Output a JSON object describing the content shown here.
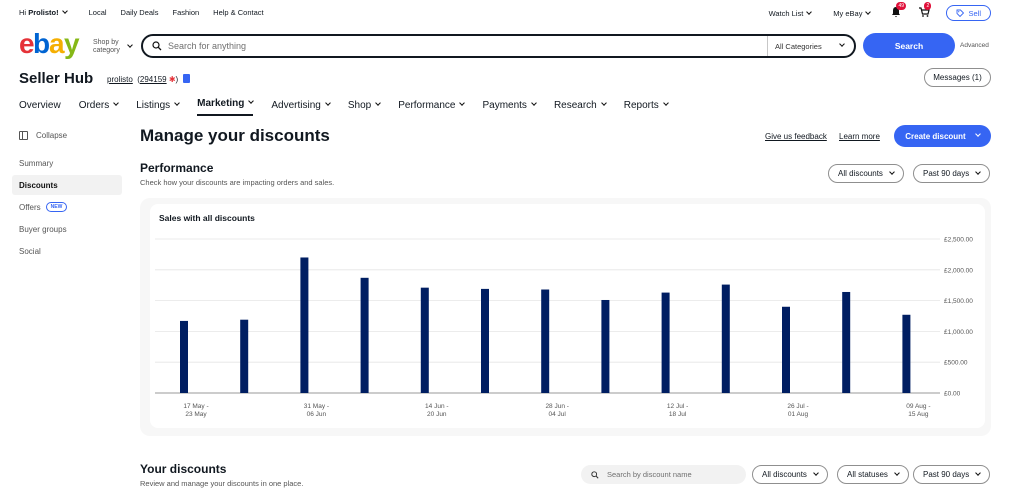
{
  "topbar": {
    "greeting_prefix": "Hi",
    "greeting_name": "Prolisto!",
    "links": [
      "Local",
      "Daily Deals",
      "Fashion",
      "Help & Contact"
    ],
    "watch_list": "Watch List",
    "my_ebay": "My eBay",
    "notif_count": "49",
    "cart_count": "2",
    "sell_label": "Sell"
  },
  "header": {
    "shop_by_line1": "Shop by",
    "shop_by_line2": "category",
    "search_placeholder": "Search for anything",
    "category_label": "All Categories",
    "search_button": "Search",
    "advanced_label": "Advanced"
  },
  "sellerhub": {
    "title": "Seller Hub",
    "username": "prolisto",
    "feedback_score": "294159",
    "messages_label": "Messages (1)"
  },
  "nav": {
    "items": [
      {
        "label": "Overview",
        "chevron": false
      },
      {
        "label": "Orders",
        "chevron": true
      },
      {
        "label": "Listings",
        "chevron": true
      },
      {
        "label": "Marketing",
        "chevron": true,
        "active": true
      },
      {
        "label": "Advertising",
        "chevron": true
      },
      {
        "label": "Shop",
        "chevron": true
      },
      {
        "label": "Performance",
        "chevron": true
      },
      {
        "label": "Payments",
        "chevron": true
      },
      {
        "label": "Research",
        "chevron": true
      },
      {
        "label": "Reports",
        "chevron": true
      }
    ]
  },
  "sidebar": {
    "collapse_label": "Collapse",
    "items": [
      {
        "label": "Summary"
      },
      {
        "label": "Discounts",
        "active": true
      },
      {
        "label": "Offers",
        "badge": "NEW"
      },
      {
        "label": "Buyer groups"
      },
      {
        "label": "Social"
      }
    ]
  },
  "main": {
    "title": "Manage your discounts",
    "feedback_link": "Give us feedback",
    "learn_more_link": "Learn more",
    "create_button": "Create discount",
    "performance": {
      "title": "Performance",
      "subtitle": "Check how your discounts are impacting orders and sales.",
      "filter_discounts": "All discounts",
      "filter_period": "Past 90 days"
    },
    "your_discounts": {
      "title": "Your discounts",
      "subtitle": "Review and manage your discounts in one place.",
      "search_placeholder": "Search by discount name",
      "filter_discounts": "All discounts",
      "filter_statuses": "All statuses",
      "filter_period": "Past 90 days"
    }
  },
  "colors": {
    "accent": "#3665f3",
    "bar": "#001e62",
    "logo_e": "#e53238",
    "logo_b": "#0064d2",
    "logo_a": "#f5af02",
    "logo_y": "#86b817"
  },
  "chart_data": {
    "type": "bar",
    "title": "Sales with all discounts",
    "ylim": [
      0,
      2500
    ],
    "y_ticks": [
      "£0.00",
      "£500.00",
      "£1,000.00",
      "£1,500.00",
      "£2,000.00",
      "£2,500.00"
    ],
    "x_tick_labels": [
      [
        "17 May -",
        "23 May"
      ],
      [
        "31 May -",
        "06 Jun"
      ],
      [
        "14 Jun -",
        "20 Jun"
      ],
      [
        "28 Jun -",
        "04 Jul"
      ],
      [
        "12 Jul -",
        "18 Jul"
      ],
      [
        "26 Jul -",
        "01 Aug"
      ],
      [
        "09 Aug -",
        "15 Aug"
      ]
    ],
    "values": [
      1170,
      1190,
      2200,
      1870,
      1710,
      1690,
      1680,
      1510,
      1630,
      1760,
      1400,
      1640,
      1270
    ],
    "grid": true
  }
}
